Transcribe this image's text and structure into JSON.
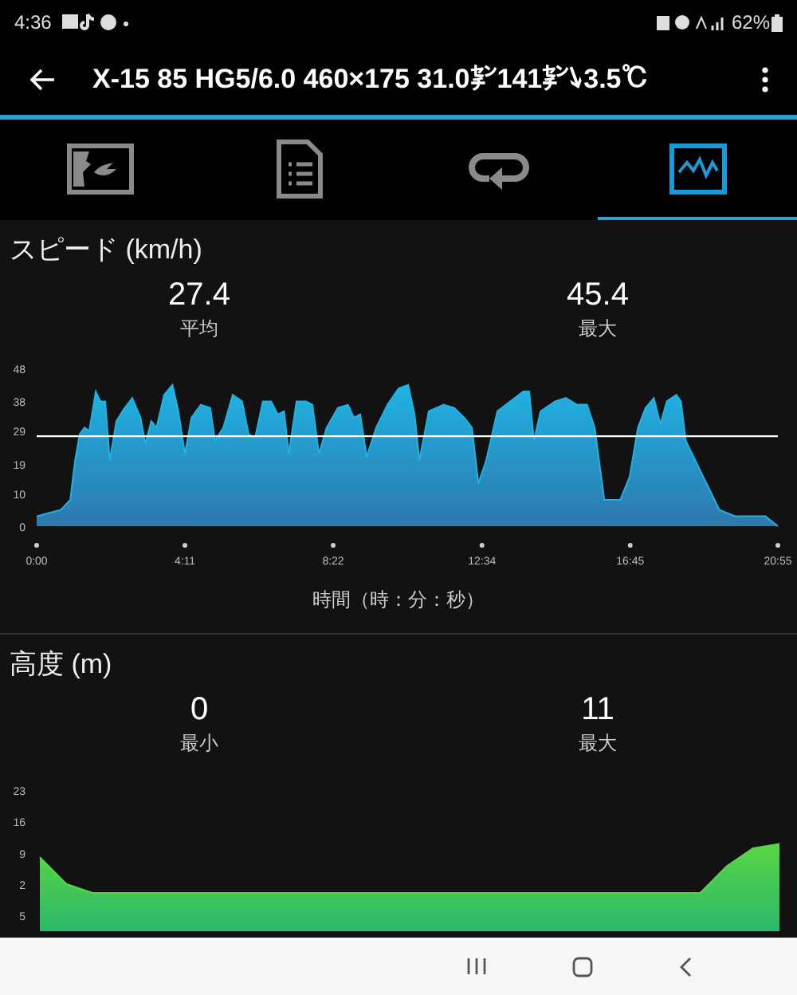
{
  "status_bar": {
    "time": "4:36",
    "battery": "62%"
  },
  "app_bar": {
    "title": "X-15 85 HG5/6.0 460×175 31.0㌢141㌢↘3.5℃"
  },
  "tabs": [
    {
      "kind": "map",
      "selected": false
    },
    {
      "kind": "details",
      "selected": false
    },
    {
      "kind": "laps",
      "selected": false
    },
    {
      "kind": "chart",
      "selected": true
    }
  ],
  "speed": {
    "title": "スピード (km/h)",
    "stats": [
      {
        "value": "27.4",
        "label": "平均"
      },
      {
        "value": "45.4",
        "label": "最大"
      }
    ],
    "chart_data": {
      "type": "area",
      "xlabel": "時間（時：分：秒）",
      "x": [
        0,
        19,
        41,
        57,
        65,
        73,
        81,
        89,
        100,
        108,
        116,
        124,
        135,
        149,
        162,
        176,
        184,
        194,
        203,
        216,
        230,
        240,
        251,
        262,
        278,
        294,
        302,
        316,
        332,
        348,
        359,
        370,
        383,
        397,
        408,
        419,
        427,
        440,
        456,
        467,
        478,
        491,
        510,
        527,
        537,
        548,
        559,
        575,
        594,
        613,
        629,
        640,
        648,
        664,
        689,
        707,
        724,
        737,
        748,
        761,
        780,
        802,
        824,
        834,
        842,
        853,
        878,
        896,
        915,
        932,
        945,
        961,
        972,
        988,
        1004,
        1018,
        1031,
        1045,
        1056,
        1067,
        1083,
        1091,
        1099,
        1126,
        1156,
        1183,
        1234,
        1255
      ],
      "xlim": [
        0,
        1255
      ],
      "ylim": [
        0,
        48
      ],
      "series": [
        {
          "color": "#1fb3e3",
          "values": [
            3,
            4,
            5,
            8,
            20,
            28,
            30,
            29,
            41,
            38,
            38,
            20,
            32,
            36,
            39,
            33,
            25,
            32,
            30,
            40,
            43,
            35,
            22,
            33,
            37,
            36,
            26,
            30,
            40,
            38,
            28,
            27,
            38,
            38,
            34,
            35,
            22,
            38,
            38,
            37,
            22,
            30,
            36,
            37,
            33,
            34,
            21,
            30,
            37,
            42,
            43,
            34,
            20,
            35,
            37,
            36,
            33,
            30,
            13,
            20,
            35,
            38,
            41,
            41,
            26,
            35,
            38,
            39,
            37,
            37,
            30,
            8,
            8,
            8,
            15,
            30,
            36,
            39,
            31,
            38,
            40,
            38,
            26,
            16,
            5,
            3,
            3,
            0
          ]
        }
      ],
      "xticks": [
        {
          "value": 0,
          "label": "0:00"
        },
        {
          "value": 251,
          "label": "4:11"
        },
        {
          "value": 502,
          "label": "8:22"
        },
        {
          "value": 754,
          "label": "12:34"
        },
        {
          "value": 1005,
          "label": "16:45"
        },
        {
          "value": 1255,
          "label": "20:55"
        }
      ],
      "yticks": [
        {
          "value": 48,
          "label": "48"
        },
        {
          "value": 38,
          "label": "38"
        },
        {
          "value": 29,
          "label": "29"
        },
        {
          "value": 19,
          "label": "19"
        },
        {
          "value": 10,
          "label": "10"
        },
        {
          "value": 0,
          "label": "0"
        }
      ],
      "ref_lines": [
        {
          "axis": "y",
          "value": 27.4
        }
      ]
    }
  },
  "altitude": {
    "title": "高度 (m)",
    "stats": [
      {
        "value": "0",
        "label": "最小"
      },
      {
        "value": "11",
        "label": "最大"
      }
    ],
    "chart_data": {
      "type": "area",
      "categories": [
        null,
        null,
        null,
        null,
        null,
        null,
        null,
        null,
        null,
        null,
        null,
        null,
        null,
        null,
        null,
        null,
        null,
        null,
        null,
        null,
        null,
        null,
        null,
        null,
        null,
        null,
        null,
        null,
        null
      ],
      "ylim": [
        -5,
        23
      ],
      "series": [
        {
          "color": "#5ad645",
          "values": [
            8,
            2,
            0,
            0,
            0,
            0,
            0,
            0,
            0,
            0,
            0,
            0,
            0,
            0,
            0,
            0,
            0,
            0,
            0,
            0,
            0,
            0,
            0,
            0,
            0,
            0,
            6,
            10,
            11
          ]
        }
      ],
      "yticks": [
        {
          "value": 23,
          "label": "23"
        },
        {
          "value": 16,
          "label": "16"
        },
        {
          "value": 9,
          "label": "9"
        },
        {
          "value": 2,
          "label": "2"
        },
        {
          "value": -5,
          "label": "5"
        }
      ]
    }
  }
}
